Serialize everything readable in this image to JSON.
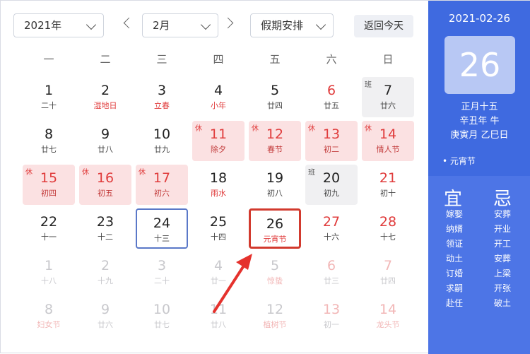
{
  "toolbar": {
    "year_value": "2021年",
    "month_value": "2月",
    "holiday_value": "假期安排",
    "today_button": "返回今天"
  },
  "weekdays": [
    "一",
    "二",
    "三",
    "四",
    "五",
    "六",
    "日"
  ],
  "days": [
    {
      "num": "1",
      "lunar": "二十"
    },
    {
      "num": "2",
      "lunar": "湿地日",
      "festival": true
    },
    {
      "num": "3",
      "lunar": "立春",
      "festival": true
    },
    {
      "num": "4",
      "lunar": "小年",
      "festival": true
    },
    {
      "num": "5",
      "lunar": "廿四"
    },
    {
      "num": "6",
      "lunar": "廿五",
      "weekend": true
    },
    {
      "num": "7",
      "lunar": "廿六",
      "workday": true,
      "badge": "班"
    },
    {
      "num": "8",
      "lunar": "廿七"
    },
    {
      "num": "9",
      "lunar": "廿八"
    },
    {
      "num": "10",
      "lunar": "廿九"
    },
    {
      "num": "11",
      "lunar": "除夕",
      "holiday": true,
      "badge": "休"
    },
    {
      "num": "12",
      "lunar": "春节",
      "holiday": true,
      "badge": "休"
    },
    {
      "num": "13",
      "lunar": "初二",
      "holiday": true,
      "badge": "休"
    },
    {
      "num": "14",
      "lunar": "情人节",
      "holiday": true,
      "badge": "休"
    },
    {
      "num": "15",
      "lunar": "初四",
      "holiday": true,
      "badge": "休"
    },
    {
      "num": "16",
      "lunar": "初五",
      "holiday": true,
      "badge": "休"
    },
    {
      "num": "17",
      "lunar": "初六",
      "holiday": true,
      "badge": "休"
    },
    {
      "num": "18",
      "lunar": "雨水",
      "festival": true
    },
    {
      "num": "19",
      "lunar": "初八"
    },
    {
      "num": "20",
      "lunar": "初九",
      "workday": true,
      "badge": "班"
    },
    {
      "num": "21",
      "lunar": "初十",
      "weekend": true
    },
    {
      "num": "22",
      "lunar": "十一"
    },
    {
      "num": "23",
      "lunar": "十二"
    },
    {
      "num": "24",
      "lunar": "十三",
      "today": true
    },
    {
      "num": "25",
      "lunar": "十四"
    },
    {
      "num": "26",
      "lunar": "元宵节",
      "festival": true,
      "selected": true
    },
    {
      "num": "27",
      "lunar": "十六",
      "weekend": true
    },
    {
      "num": "28",
      "lunar": "十七",
      "weekend": true
    },
    {
      "num": "1",
      "lunar": "十八",
      "other": true
    },
    {
      "num": "2",
      "lunar": "十九",
      "other": true
    },
    {
      "num": "3",
      "lunar": "二十",
      "other": true
    },
    {
      "num": "4",
      "lunar": "廿一",
      "other": true
    },
    {
      "num": "5",
      "lunar": "惊蛰",
      "other": true,
      "festival": true
    },
    {
      "num": "6",
      "lunar": "廿三",
      "other": true,
      "weekend": true
    },
    {
      "num": "7",
      "lunar": "廿四",
      "other": true,
      "weekend": true
    },
    {
      "num": "8",
      "lunar": "妇女节",
      "other": true,
      "festival": true
    },
    {
      "num": "9",
      "lunar": "廿六",
      "other": true
    },
    {
      "num": "10",
      "lunar": "廿七",
      "other": true
    },
    {
      "num": "11",
      "lunar": "廿八",
      "other": true
    },
    {
      "num": "12",
      "lunar": "植树节",
      "other": true,
      "festival": true
    },
    {
      "num": "13",
      "lunar": "初一",
      "other": true,
      "weekend": true
    },
    {
      "num": "14",
      "lunar": "龙头节",
      "other": true,
      "weekend": true,
      "festival": true
    }
  ],
  "panel": {
    "date": "2021-02-26",
    "big_day": "26",
    "lunar_date": "正月十五",
    "year_ganzhi": "辛丑年 牛",
    "month_day_ganzhi": "庚寅月 乙巳日",
    "festival": "• 元宵节",
    "yi_label": "宜",
    "ji_label": "忌",
    "yi_items": [
      "嫁娶",
      "纳婿",
      "领证",
      "动土",
      "订婚",
      "求嗣",
      "赴任"
    ],
    "ji_items": [
      "安葬",
      "开业",
      "开工",
      "安葬",
      "上梁",
      "开张",
      "破土"
    ]
  },
  "colors": {
    "panel_blue": "#3f6ae0",
    "holiday_bg": "#fbe1e2",
    "festival_red": "#e03c3c",
    "today_border": "#5a78c8",
    "selected_border": "#d23a2e"
  }
}
